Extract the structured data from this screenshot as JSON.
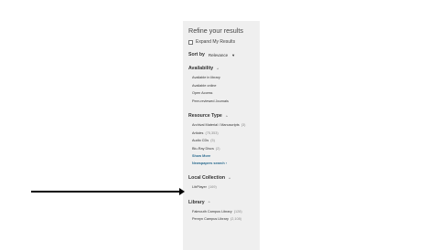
{
  "refine": {
    "title": "Refine your results",
    "expand_label": "Expand My Results"
  },
  "sort": {
    "label": "Sort by",
    "value": "Relevance",
    "caret_icon": "▼"
  },
  "sections": {
    "availability": {
      "title": "Availability",
      "items": [
        {
          "label": "Available in library",
          "count": ""
        },
        {
          "label": "Available online",
          "count": ""
        },
        {
          "label": "Open Access",
          "count": ""
        },
        {
          "label": "Peer-reviewed Journals",
          "count": ""
        }
      ]
    },
    "resource_type": {
      "title": "Resource Type",
      "items": [
        {
          "label": "Archival Material / Manuscripts",
          "count": "(3)"
        },
        {
          "label": "Articles",
          "count": "(75,353)"
        },
        {
          "label": "Audio CDs",
          "count": "(5)"
        },
        {
          "label": "Blu-Ray Discs",
          "count": "(2)"
        }
      ],
      "show_more": "Show More",
      "newspapers": "Newspapers search"
    },
    "local_collection": {
      "title": "Local Collection",
      "items": [
        {
          "label": "LibPlayer",
          "count": "(169)"
        }
      ]
    },
    "library": {
      "title": "Library",
      "items": [
        {
          "label": "Falmouth Campus Library",
          "count": "(128)"
        },
        {
          "label": "Penryn Campus Library",
          "count": "(2,108)"
        }
      ]
    }
  },
  "icons": {
    "chevron_up": "^",
    "newspapers_arrow": "›"
  }
}
